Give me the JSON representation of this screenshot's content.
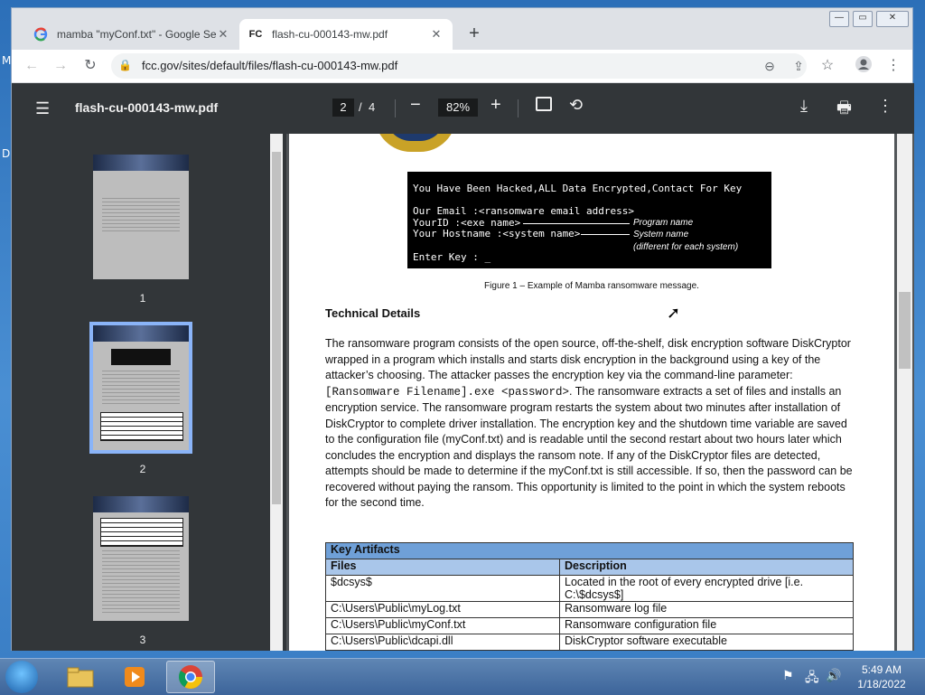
{
  "desktop": {
    "letters": [
      "M",
      "D"
    ]
  },
  "tabs": [
    {
      "title": "mamba \"myConf.txt\" - Google Se",
      "favicon": "google-icon"
    },
    {
      "title": "flash-cu-000143-mw.pdf",
      "favicon": "fc-icon"
    }
  ],
  "toolbar": {
    "url": "fcc.gov/sites/default/files/flash-cu-000143-mw.pdf"
  },
  "pdf": {
    "file_name": "flash-cu-000143-mw.pdf",
    "current_page": "2",
    "page_sep": "/",
    "total_pages": "4",
    "zoom": "82%"
  },
  "thumbnails": [
    {
      "label": "1"
    },
    {
      "label": "2"
    },
    {
      "label": "3"
    }
  ],
  "document": {
    "terminal": {
      "line1": "You Have Been Hacked,ALL Data Encrypted,Contact For Key",
      "line2": "Our Email :<ransomware email address>",
      "line3": "YourID :<exe name>",
      "line4": "Your Hostname :<system name>",
      "line5": "Enter Key : _",
      "ann1": "Program name",
      "ann2": "System name",
      "ann3": "(different for each system)"
    },
    "caption": "Figure 1 – Example of Mamba ransomware message.",
    "heading": "Technical Details",
    "para_a": "The ransomware program consists of the open source, off-the-shelf, disk encryption software DiskCryptor wrapped in a program which installs and starts disk encryption in the background using a key of the attacker’s choosing. The attacker passes the encryption key via the command-line parameter: ",
    "para_code": "[Ransomware Filename].exe <password>",
    "para_b": ". The ransomware extracts a set of files and installs an encryption service. The ransomware program restarts the system about two minutes after installation of DiskCryptor to complete driver installation. The encryption key and the shutdown time variable are saved to the configuration file (myConf.txt) and is readable until the second restart about two hours later which concludes the encryption and displays the ransom note. If any of the DiskCryptor files are detected, attempts should be made to determine if the myConf.txt is still accessible. If so, then the password can be recovered without paying the ransom. This opportunity is limited to the point in which the system reboots for the second time.",
    "table": {
      "title": "Key Artifacts",
      "headers": [
        "Files",
        "Description"
      ],
      "rows": [
        [
          "$dcsys$",
          "Located in the root of every encrypted drive [i.e. C:\\$dcsys$]"
        ],
        [
          "C:\\Users\\Public\\myLog.txt",
          "Ransomware log file"
        ],
        [
          "C:\\Users\\Public\\myConf.txt",
          "Ransomware configuration file"
        ],
        [
          "C:\\Users\\Public\\dcapi.dll",
          "DiskCryptor software executable"
        ]
      ]
    }
  },
  "taskbar": {
    "time": "5:49 AM",
    "date": "1/18/2022"
  }
}
